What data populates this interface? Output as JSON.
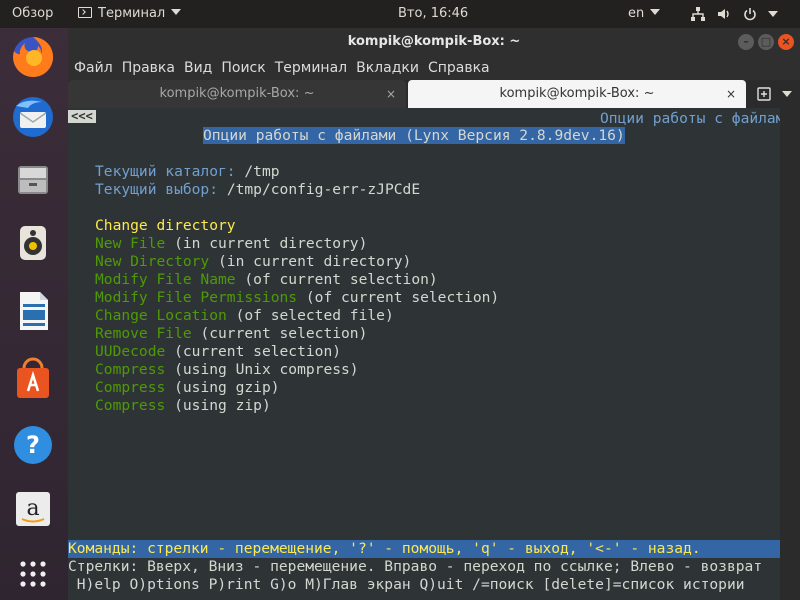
{
  "top_panel": {
    "activities": "Обзор",
    "app_menu": "Терминал",
    "clock": "Вто, 16:46",
    "language": "en"
  },
  "dock": {
    "items": [
      "firefox-icon",
      "thunderbird-icon",
      "files-icon",
      "rhythmbox-icon",
      "libreoffice-writer-icon",
      "software-center-icon",
      "help-icon",
      "amazon-icon",
      "show-apps-icon"
    ]
  },
  "window": {
    "title": "kompik@kompik-Box: ~",
    "menu": [
      "Файл",
      "Правка",
      "Вид",
      "Поиск",
      "Терминал",
      "Вкладки",
      "Справка"
    ],
    "tabs": [
      {
        "label": "kompik@kompik-Box: ~",
        "close": "×"
      },
      {
        "label": "kompik@kompik-Box: ~",
        "close": "×"
      }
    ],
    "new_tab": "⊕"
  },
  "lynx": {
    "back": "<<<",
    "top_right": "Опции работы с файлами",
    "header": "Опции работы с файлами (Lynx Версия 2.8.9dev.16)",
    "cwd_label": "Текущий каталог:",
    "cwd_value": "/tmp",
    "sel_label": "Текущий выбор:",
    "sel_value": "/tmp/config-err-zJPCdE",
    "options": [
      {
        "link": "Change directory",
        "rest": ""
      },
      {
        "link": "New File",
        "rest": " (in current directory)"
      },
      {
        "link": "New Directory",
        "rest": " (in current directory)"
      },
      {
        "link": "Modify File Name",
        "rest": " (of current selection)"
      },
      {
        "link": "Modify File Permissions",
        "rest": " (of current selection)"
      },
      {
        "link": "Change Location",
        "rest": " (of selected file)"
      },
      {
        "link": "Remove File",
        "rest": " (current selection)"
      },
      {
        "link": "UUDecode",
        "rest": " (current selection)"
      },
      {
        "link": "Compress",
        "rest": " (using Unix compress)"
      },
      {
        "link": "Compress",
        "rest": " (using gzip)"
      },
      {
        "link": "Compress",
        "rest": " (using zip)"
      }
    ],
    "status_line": "Команды: стрелки - перемещение, '?' - помощь, 'q' - выход, '<-' - назад.",
    "help_line1": "Стрелки: Вверх, Вниз - перемещение. Вправо - переход по ссылке; Влево - возврат",
    "help_line2": " H)elp O)ptions P)rint G)o M)Глав экран Q)uit /=поиск [delete]=список истории"
  },
  "colors": {
    "accent": "#e95420",
    "terminal_bg": "#2e3436",
    "link_selected": "#fce94f",
    "link": "#4e9a06",
    "status_bg": "#3465a4"
  }
}
